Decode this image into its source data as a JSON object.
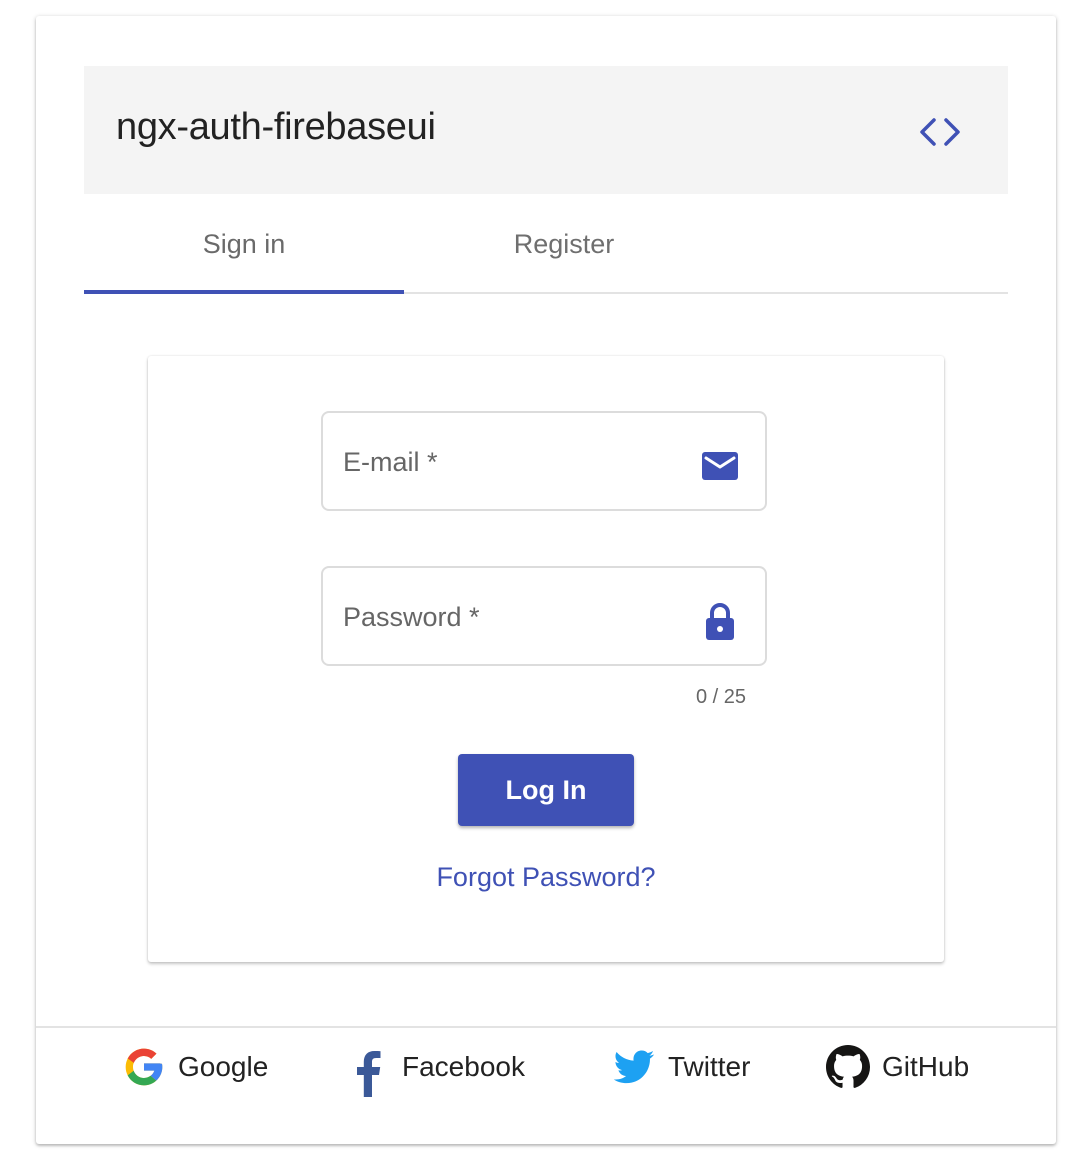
{
  "header": {
    "title": "ngx-auth-firebaseui",
    "code_toggle_icon": "code-brackets-icon"
  },
  "tabs": [
    {
      "label": "Sign in",
      "active": true
    },
    {
      "label": "Register",
      "active": false
    }
  ],
  "form": {
    "email": {
      "label": "E-mail *",
      "icon": "mail-icon"
    },
    "password": {
      "label": "Password *",
      "icon": "lock-icon",
      "hint": "0 / 25"
    },
    "login_label": "Log In",
    "forgot_label": "Forgot Password?"
  },
  "providers": [
    {
      "label": "Google",
      "icon": "google-icon"
    },
    {
      "label": "Facebook",
      "icon": "facebook-icon"
    },
    {
      "label": "Twitter",
      "icon": "twitter-icon"
    },
    {
      "label": "GitHub",
      "icon": "github-icon"
    }
  ],
  "colors": {
    "accent": "#3f51b5",
    "header_bg": "#f4f4f4",
    "google_blue": "#4285f4",
    "google_red": "#ea4335",
    "google_yellow": "#fbbc05",
    "google_green": "#34a853",
    "facebook": "#3b5998",
    "twitter": "#1da1f2",
    "github": "#161514"
  }
}
